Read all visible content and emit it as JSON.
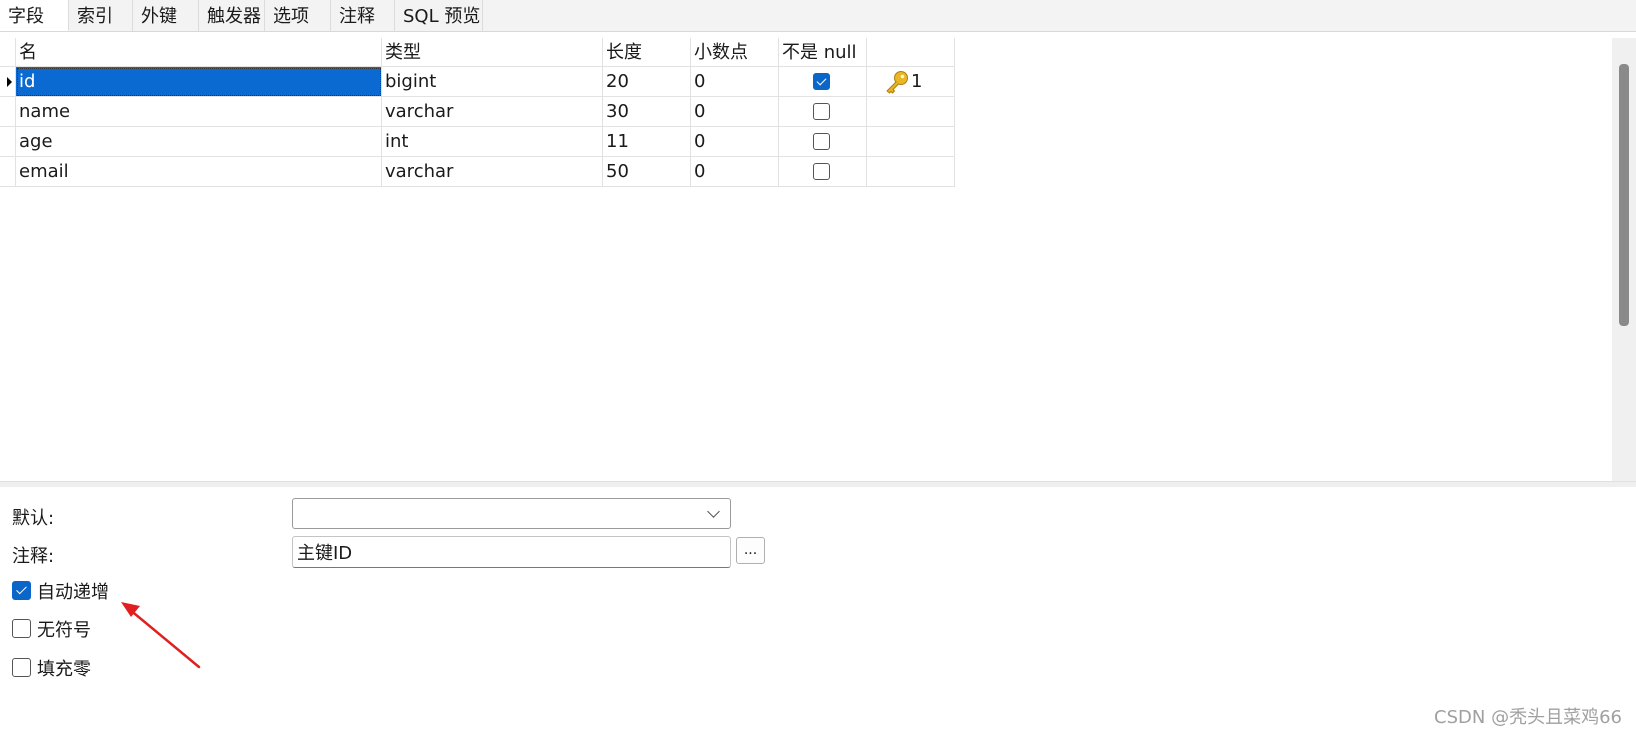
{
  "tabs": [
    "字段",
    "索引",
    "外键",
    "触发器",
    "选项",
    "注释",
    "SQL 预览"
  ],
  "active_tab": "字段",
  "grid": {
    "columns": [
      "名",
      "类型",
      "长度",
      "小数点",
      "不是 null",
      ""
    ],
    "rows": [
      {
        "name": "id",
        "type": "bigint",
        "length": "20",
        "decimals": "0",
        "not_null": true,
        "key": "1",
        "selected": true
      },
      {
        "name": "name",
        "type": "varchar",
        "length": "30",
        "decimals": "0",
        "not_null": false,
        "key": ""
      },
      {
        "name": "age",
        "type": "int",
        "length": "11",
        "decimals": "0",
        "not_null": false,
        "key": ""
      },
      {
        "name": "email",
        "type": "varchar",
        "length": "50",
        "decimals": "0",
        "not_null": false,
        "key": ""
      }
    ]
  },
  "properties": {
    "default_label": "默认:",
    "default_value": "",
    "comment_label": "注释:",
    "comment_value": "主键ID",
    "ellipsis_label": "...",
    "options": [
      {
        "label": "自动递增",
        "checked": true
      },
      {
        "label": "无符号",
        "checked": false
      },
      {
        "label": "填充零",
        "checked": false
      }
    ]
  },
  "annotation": {
    "arrow_color": "#e02020"
  },
  "colors": {
    "selection": "#0a6ad2",
    "checkbox_checked": "#0a67c9",
    "key_icon": "#e8b21c"
  },
  "watermark": "CSDN @秃头且菜鸡66"
}
